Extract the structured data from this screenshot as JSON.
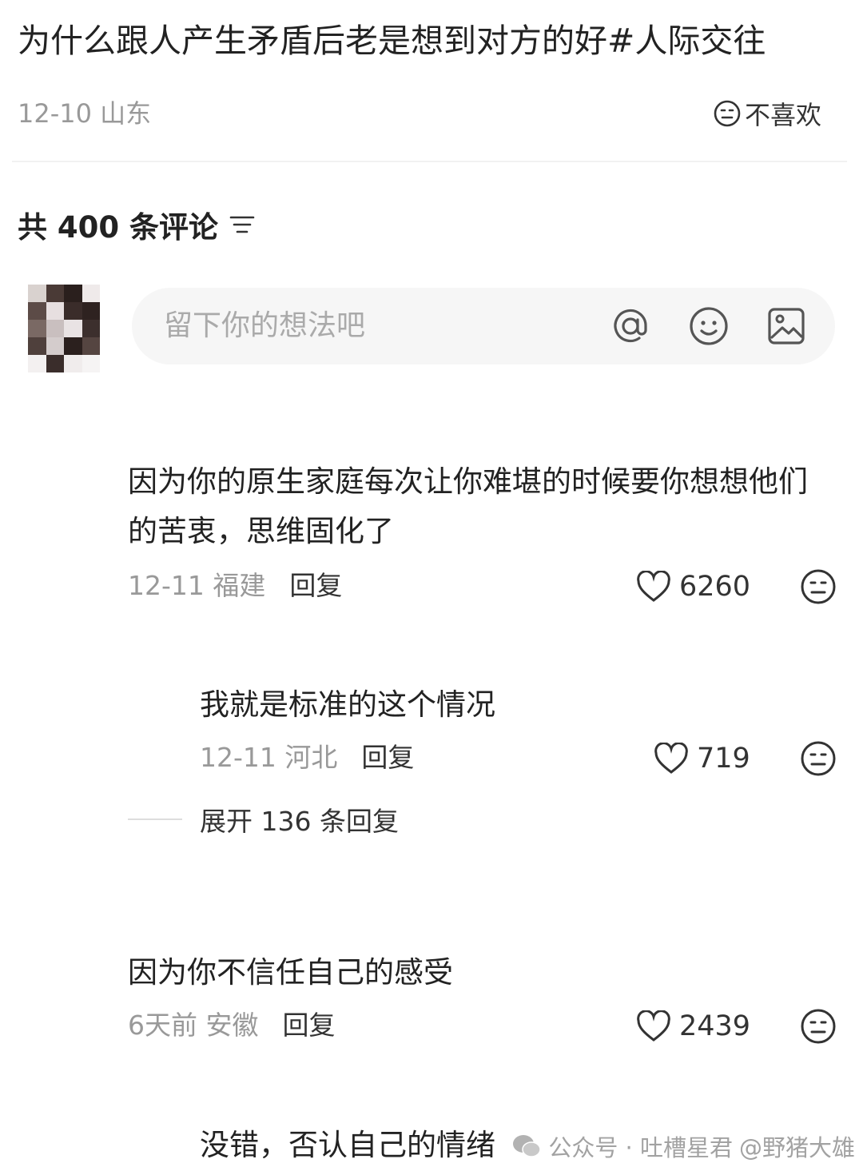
{
  "post": {
    "title": "为什么跟人产生矛盾后老是想到对方的好",
    "topic": "#人际交往",
    "date": "12-10",
    "location": "山东",
    "dislike_label": "不喜欢"
  },
  "comments_header": {
    "count_label": "共 400 条评论"
  },
  "input": {
    "placeholder": "留下你的想法吧"
  },
  "comments": [
    {
      "text": "因为你的原生家庭每次让你难堪的时候要你想想他们的苦衷，思维固化了",
      "date": "12-11",
      "location": "福建",
      "reply_label": "回复",
      "likes": "6260"
    },
    {
      "text": "我就是标准的这个情况",
      "date": "12-11",
      "location": "河北",
      "reply_label": "回复",
      "likes": "719"
    },
    {
      "text": "因为你不信任自己的感受",
      "date": "6天前",
      "location": "安徽",
      "reply_label": "回复",
      "likes": "2439"
    },
    {
      "text": "没错，否认自己的情绪"
    }
  ],
  "expand_replies_label": "展开 136 条回复",
  "watermark": {
    "text": "公众号 · 吐槽星君",
    "handle": "@野猪大雄"
  },
  "icons": {
    "at": "at-icon",
    "emoji": "emoji-icon",
    "image": "image-icon",
    "like": "heart-icon",
    "dislike": "neutral-face-icon",
    "sort": "sort-icon"
  }
}
